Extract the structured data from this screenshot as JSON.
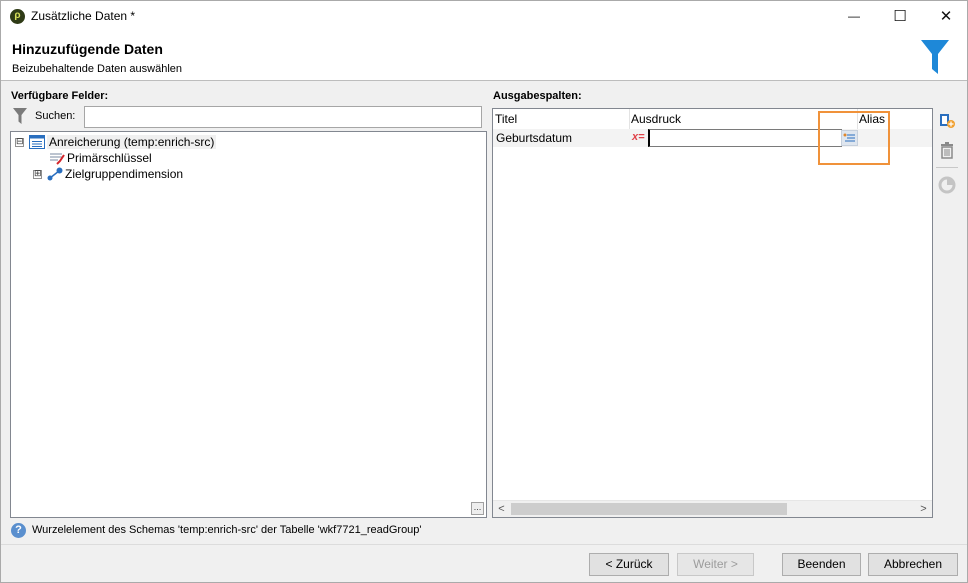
{
  "window": {
    "title": "Zusätzliche Daten *",
    "controls": {
      "minimize": "—",
      "maximize": "☐",
      "close": "✕"
    }
  },
  "header": {
    "title": "Hinzuzufügende Daten",
    "subtitle": "Beizubehaltende Daten auswählen",
    "icon": "funnel-icon",
    "accent_color": "#1e88d8"
  },
  "left_panel": {
    "label": "Verfügbare Felder:",
    "search": {
      "label": "Suchen:",
      "value": "",
      "placeholder": ""
    },
    "tree": [
      {
        "label": "Anreicherung (temp:enrich-src)",
        "expander": "⊟",
        "icon": "table-node-icon",
        "selected": true
      },
      {
        "label": "Primärschlüssel",
        "icon": "primary-key-icon"
      },
      {
        "label": "Zielgruppendimension",
        "expander": "⊞",
        "icon": "link-icon"
      }
    ],
    "corner_button": "…"
  },
  "right_panel": {
    "label": "Ausgabespalten:",
    "columns": [
      "Titel",
      "Ausdruck",
      "Alias"
    ],
    "rows": [
      {
        "title": "Geburtsdatum",
        "expression_icon": "x=",
        "expression": "",
        "alias": ""
      }
    ],
    "scroll": {
      "left": "<",
      "right": ">"
    }
  },
  "side_tools": [
    "add-column-icon",
    "delete-icon",
    "distribution-icon"
  ],
  "status": {
    "icon": "?",
    "text": "Wurzelelement des Schemas 'temp:enrich-src' der Tabelle 'wkf7721_readGroup'"
  },
  "footer": {
    "back": "< Zurück",
    "next": "Weiter >",
    "finish": "Beenden",
    "cancel": "Abbrechen"
  },
  "highlight_color": "#f0923a"
}
